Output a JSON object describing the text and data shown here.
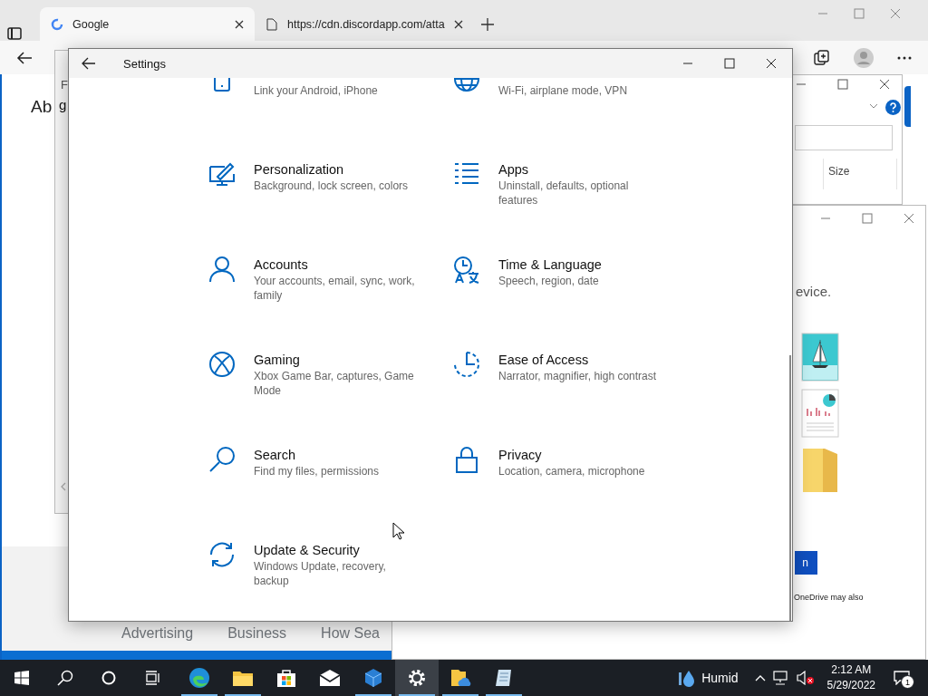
{
  "browser": {
    "tabs": [
      {
        "title": "Google",
        "selected": true
      },
      {
        "title": "https://cdn.discordapp.com/atta",
        "selected": false
      }
    ],
    "page_heading": "Ab",
    "footer_links": [
      "Advertising",
      "Business",
      "How Sea"
    ]
  },
  "background_window": {
    "label": "F",
    "text": "g"
  },
  "file_dialog": {
    "column_header": "Size"
  },
  "onedrive_window": {
    "text": "evice.",
    "button_label": "n",
    "note": "OneDrive may also"
  },
  "settings": {
    "title": "Settings",
    "items": [
      {
        "kind": "phone",
        "description": "Link your Android, iPhone"
      },
      {
        "kind": "network",
        "description": "Wi-Fi, airplane mode, VPN"
      },
      {
        "kind": "personalization",
        "title": "Personalization",
        "description": "Background, lock screen, colors"
      },
      {
        "kind": "apps",
        "title": "Apps",
        "description": "Uninstall, defaults, optional features"
      },
      {
        "kind": "accounts",
        "title": "Accounts",
        "description": "Your accounts, email, sync, work, family"
      },
      {
        "kind": "time",
        "title": "Time & Language",
        "description": "Speech, region, date"
      },
      {
        "kind": "gaming",
        "title": "Gaming",
        "description": "Xbox Game Bar, captures, Game Mode"
      },
      {
        "kind": "ease",
        "title": "Ease of Access",
        "description": "Narrator, magnifier, high contrast"
      },
      {
        "kind": "search",
        "title": "Search",
        "description": "Find my files, permissions"
      },
      {
        "kind": "privacy",
        "title": "Privacy",
        "description": "Location, camera, microphone"
      },
      {
        "kind": "update",
        "title": "Update & Security",
        "description": "Windows Update, recovery, backup"
      }
    ]
  },
  "taskbar": {
    "apps": [
      {
        "kind": "edge",
        "running": true,
        "selected": false
      },
      {
        "kind": "explorer",
        "running": true,
        "selected": false
      },
      {
        "kind": "store",
        "running": false,
        "selected": false
      },
      {
        "kind": "mail",
        "running": false,
        "selected": false
      },
      {
        "kind": "cube",
        "running": true,
        "selected": false
      },
      {
        "kind": "settings",
        "running": true,
        "selected": true
      },
      {
        "kind": "cloudfolder",
        "running": true,
        "selected": false
      },
      {
        "kind": "notepad",
        "running": true,
        "selected": false
      }
    ],
    "weather": "Humid",
    "time": "2:12 AM",
    "date": "5/29/2022",
    "notification_count": "1"
  }
}
